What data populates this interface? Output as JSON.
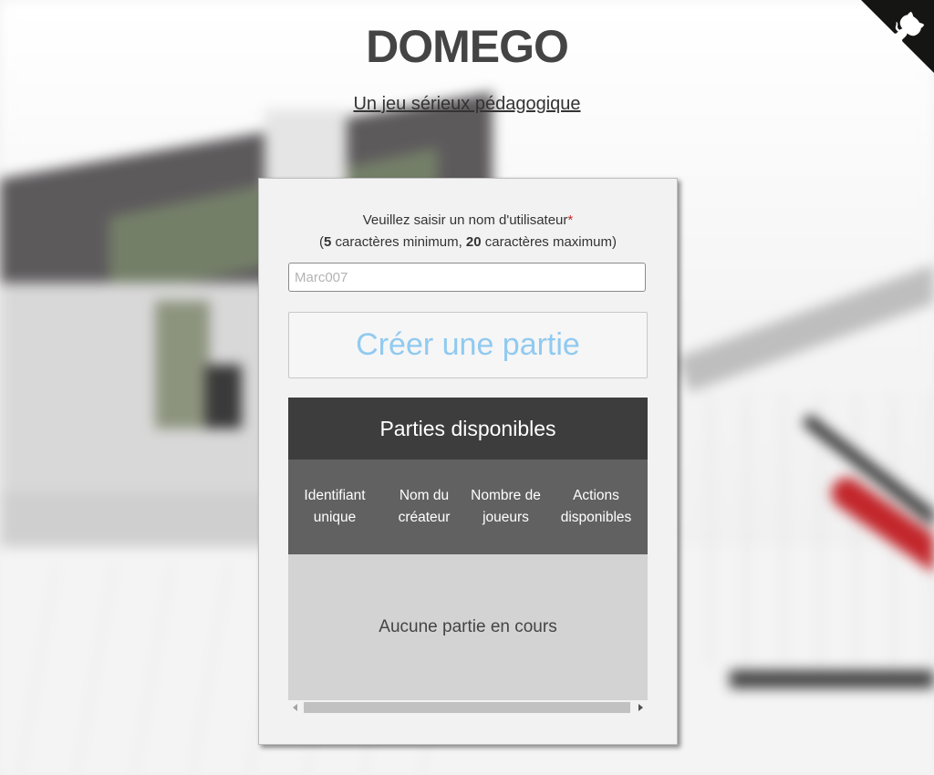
{
  "header": {
    "title": "DOMEGO",
    "subtitle_link": "Un jeu sérieux pédagogique"
  },
  "github_corner": {
    "icon": "github-octocat-icon",
    "background_color": "#151513",
    "icon_color": "#ffffff"
  },
  "form": {
    "prompt_line1": "Veuillez saisir un nom d'utilisateur",
    "required_mark": "*",
    "prompt_open": "(",
    "min_value": "5",
    "min_text": " caractères minimum, ",
    "max_value": "20",
    "max_text": " caractères maximum)",
    "username_placeholder": "Marc007",
    "username_value": "",
    "create_button_label": "Créer une partie"
  },
  "games_table": {
    "caption": "Parties disponibles",
    "columns": [
      "Identifiant unique",
      "Nom du créateur",
      "Nombre de joueurs",
      "Actions disponibles"
    ],
    "empty_message": "Aucune partie en cours"
  },
  "colors": {
    "table_caption_bg": "#3d3d3d",
    "table_header_bg": "#616161",
    "table_body_bg": "#d3d3d3",
    "create_button_text": "#90caf0",
    "required_mark": "#c62828"
  }
}
